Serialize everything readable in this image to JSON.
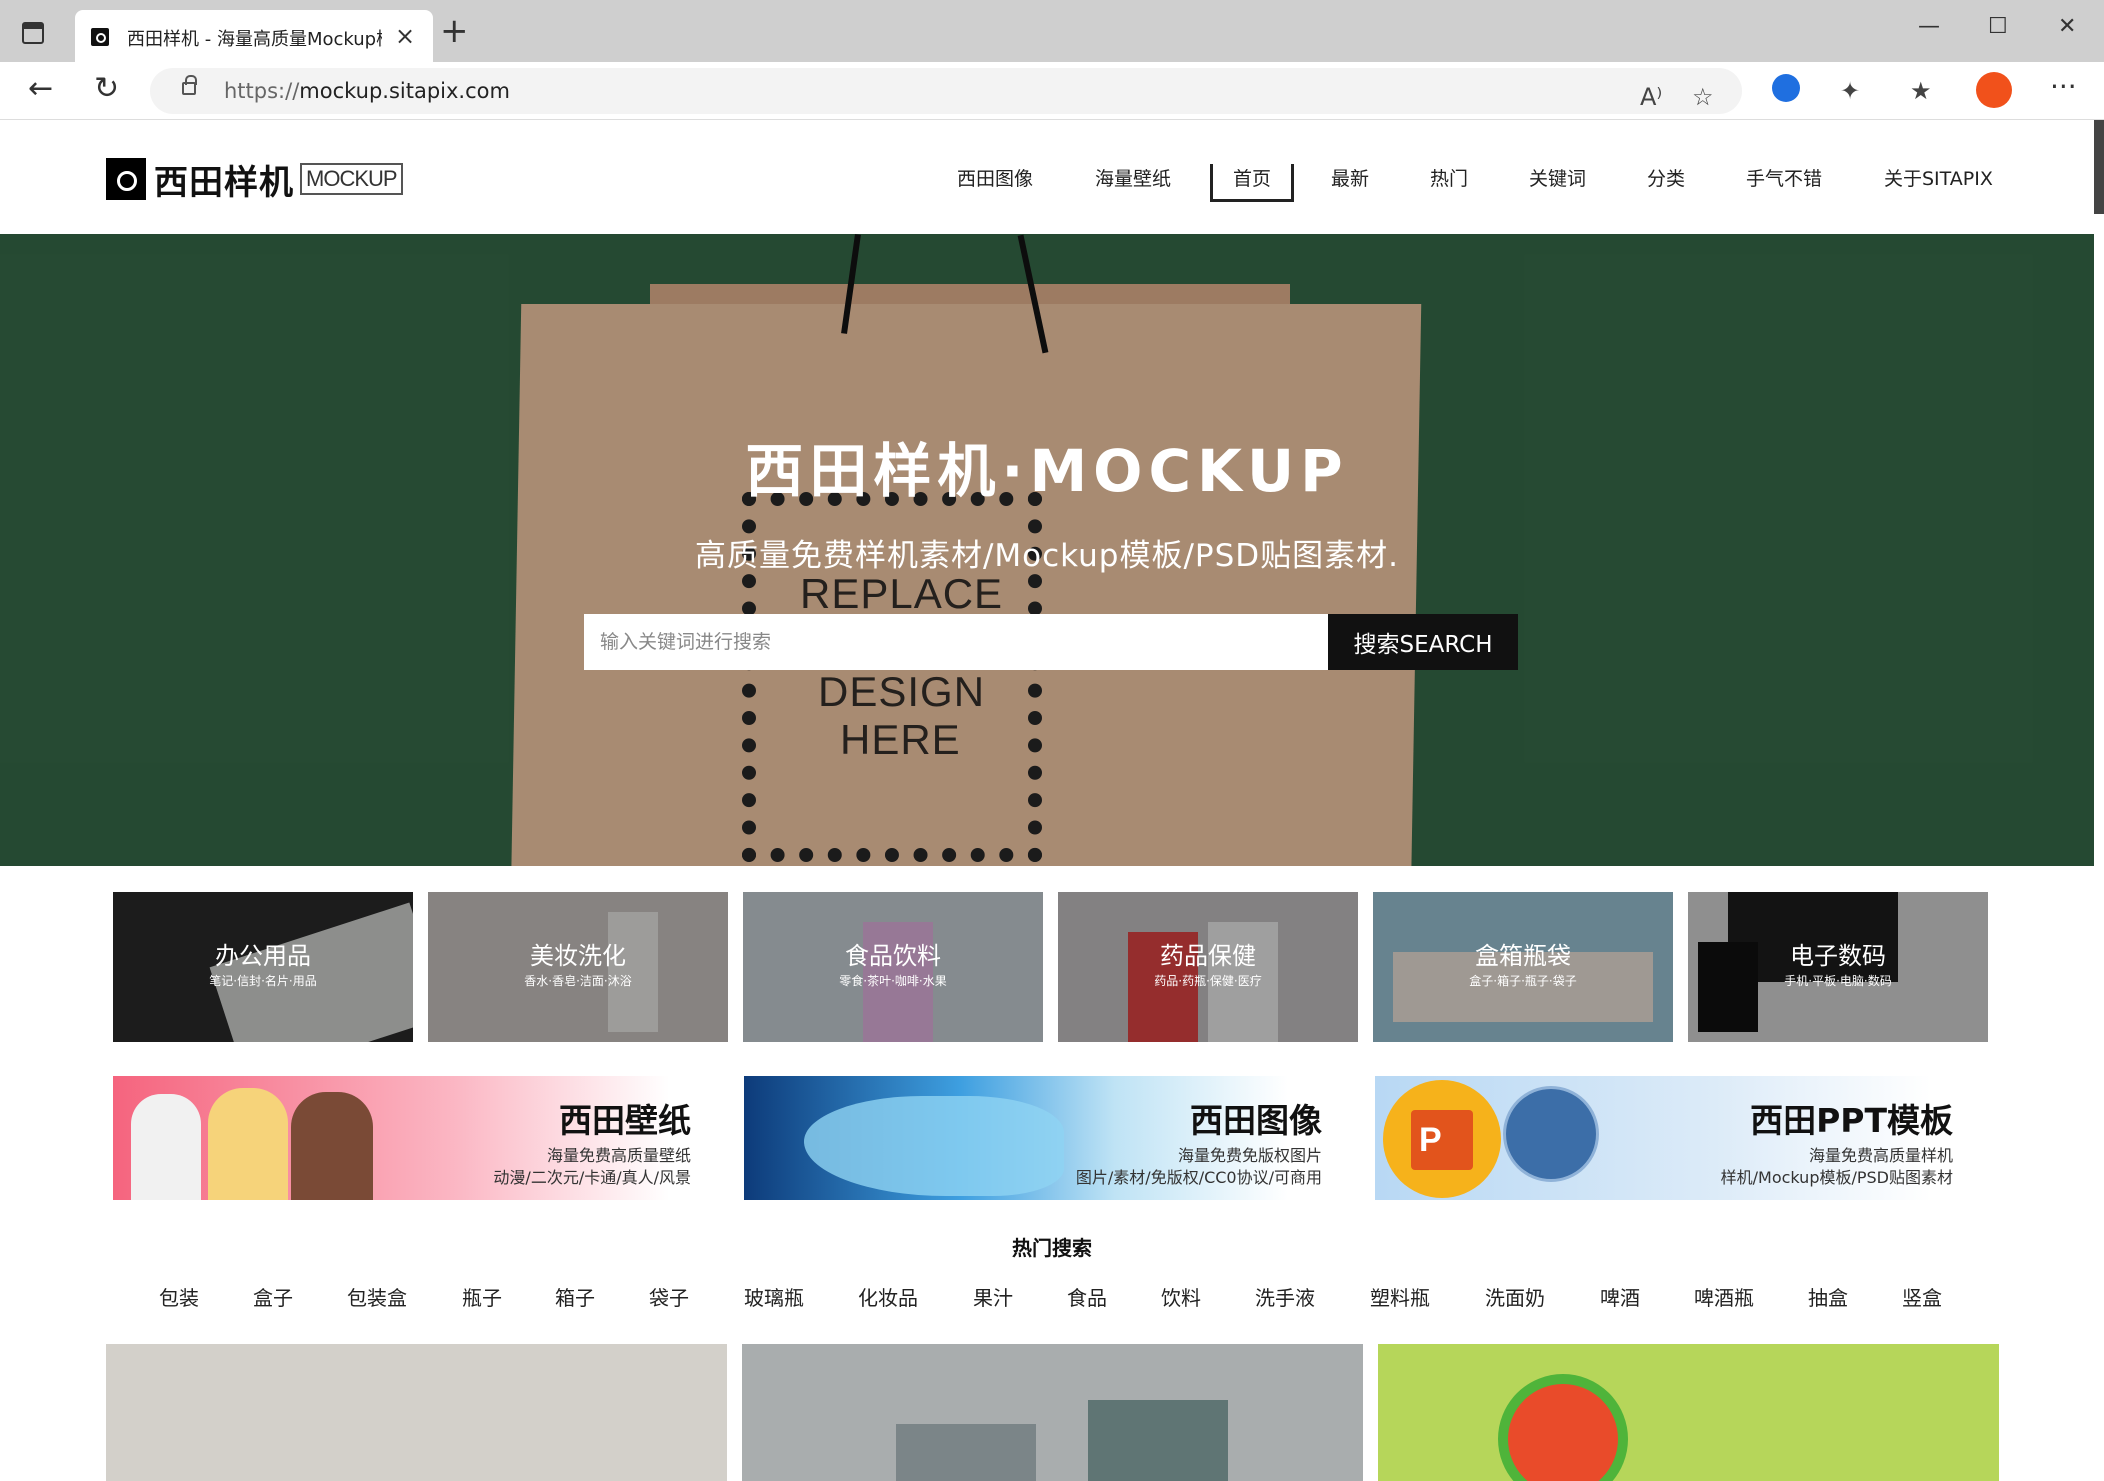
{
  "browser": {
    "tab_title": "西田样机 - 海量高质量Mockup模",
    "tab_close": "×",
    "new_tab": "+",
    "url_scheme": "https://",
    "url_host": "mockup.sitapix.com",
    "window_minimize": "—",
    "window_maximize": "☐",
    "window_close": "✕",
    "menu": "···",
    "read_aloud": "A⁾"
  },
  "site": {
    "logo_cn": "西田样机",
    "logo_en": "MOCKUP",
    "nav": [
      "西田图像",
      "海量壁纸",
      "首页",
      "最新",
      "热门",
      "关键词",
      "分类",
      "手气不错",
      "关于SITAPIX"
    ],
    "nav_active_index": 2
  },
  "hero": {
    "title": "西田样机·MOCKUP",
    "subtitle": "高质量免费样机素材/Mockup模板/PSD贴图素材.",
    "search_placeholder": "输入关键词进行搜索",
    "search_button": "搜索SEARCH",
    "bag_text_1": "REPLACE",
    "bag_text_2": "DESIGN",
    "bag_text_3": "HERE",
    "bg_color": "#2e5a3e"
  },
  "categories": [
    {
      "title": "办公用品",
      "sub": "笔记·信封·名片·用品",
      "bg": "#3a3a3a"
    },
    {
      "title": "美妆洗化",
      "sub": "香水·香皂·洁面·沐浴",
      "bg": "#cfcac6"
    },
    {
      "title": "食品饮料",
      "sub": "零食·茶叶·咖啡·水果",
      "bg": "#cdd6dc"
    },
    {
      "title": "药品保健",
      "sub": "药品·药瓶·保健·医疗",
      "bg": "#c9c7c8"
    },
    {
      "title": "盒箱瓶袋",
      "sub": "盒子·箱子·瓶子·袋子",
      "bg": "#9fc9dc"
    },
    {
      "title": "电子数码",
      "sub": "手机·平板·电脑·数码",
      "bg": "#dcdcdc"
    }
  ],
  "banners": [
    {
      "title": "西田壁纸",
      "line1": "海量免费高质量壁纸",
      "line2": "动漫/二次元/卡通/真人/风景"
    },
    {
      "title": "西田图像",
      "line1": "海量免费免版权图片",
      "line2": "图片/素材/免版权/CC0协议/可商用"
    },
    {
      "title": "西田PPT模板",
      "line1": "海量免费高质量样机",
      "line2": "样机/Mockup模板/PSD贴图素材"
    }
  ],
  "hot_search": {
    "title": "热门搜索",
    "tags": [
      "包装",
      "盒子",
      "包装盒",
      "瓶子",
      "箱子",
      "袋子",
      "玻璃瓶",
      "化妆品",
      "果汁",
      "食品",
      "饮料",
      "洗手液",
      "塑料瓶",
      "洗面奶",
      "啤酒",
      "啤酒瓶",
      "抽盒",
      "竖盒"
    ]
  },
  "thumbs": [
    {
      "bg": "#d3d0ca"
    },
    {
      "bg": "#a9adae"
    },
    {
      "bg": "#b6d65a"
    }
  ]
}
